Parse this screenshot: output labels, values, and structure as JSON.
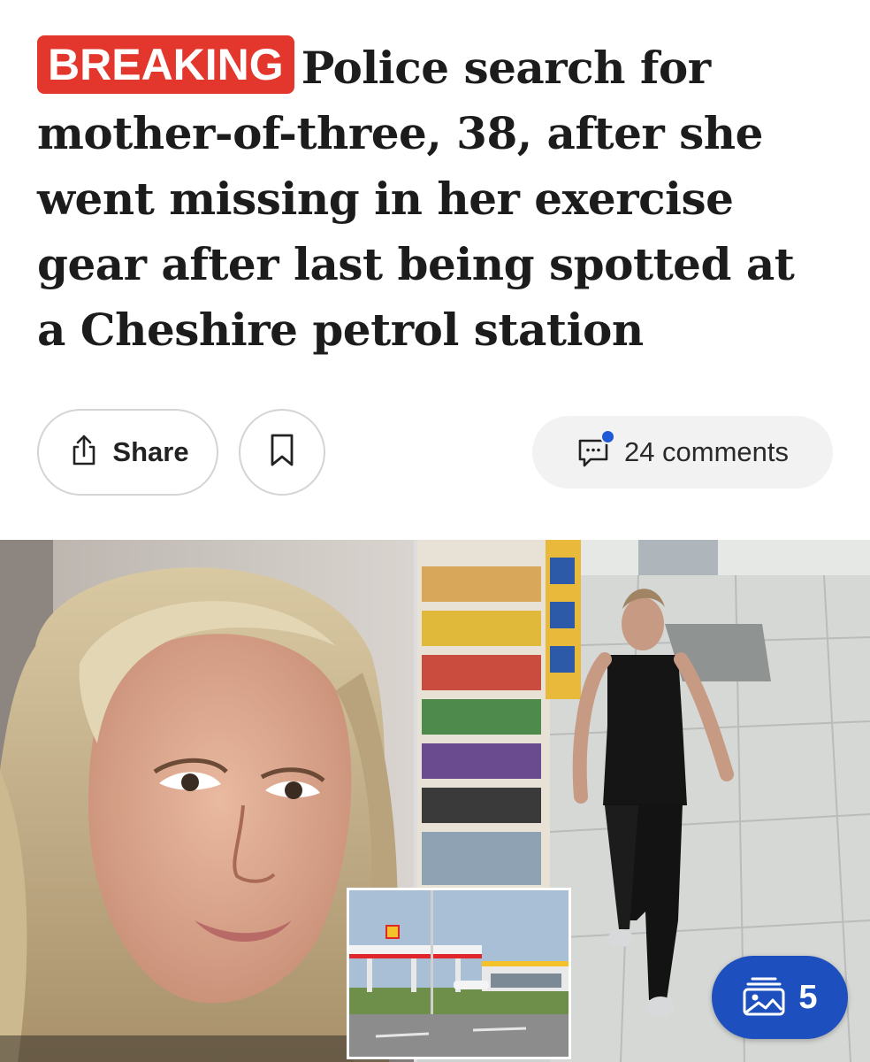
{
  "article": {
    "badge": "BREAKING",
    "headline": "Police search for mother-of-three, 38, after she went missing in her exercise gear after last being spotted at a Cheshire petrol station"
  },
  "actions": {
    "share_label": "Share",
    "comments_label": "24 comments"
  },
  "gallery": {
    "count": "5"
  },
  "colors": {
    "badge_red": "#e3362c",
    "gallery_blue": "#1e4fbe",
    "notification_dot": "#1f5ad6"
  },
  "icons": [
    "share-icon",
    "bookmark-icon",
    "comment-icon",
    "gallery-icon"
  ]
}
